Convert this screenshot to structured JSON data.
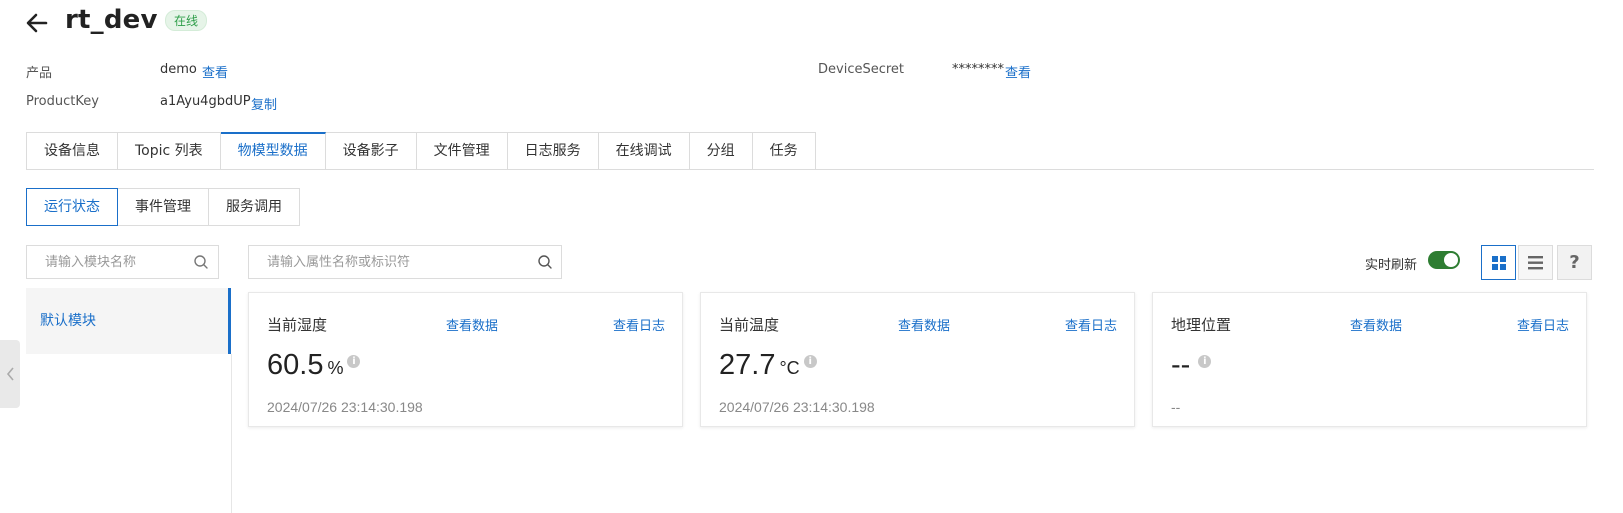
{
  "device": {
    "name": "rt_dev",
    "status": "在线"
  },
  "meta": {
    "product_label": "产品",
    "product_value": "demo",
    "product_link": "查看",
    "productkey_label": "ProductKey",
    "productkey_value": "a1Ayu4gbdUP",
    "productkey_link": "复制",
    "secret_label": "DeviceSecret",
    "secret_value": "********",
    "secret_link": "查看"
  },
  "tabs": [
    {
      "label": "设备信息"
    },
    {
      "label": "Topic 列表"
    },
    {
      "label": "物模型数据"
    },
    {
      "label": "设备影子"
    },
    {
      "label": "文件管理"
    },
    {
      "label": "日志服务"
    },
    {
      "label": "在线调试"
    },
    {
      "label": "分组"
    },
    {
      "label": "任务"
    }
  ],
  "subtabs": [
    {
      "label": "运行状态"
    },
    {
      "label": "事件管理"
    },
    {
      "label": "服务调用"
    }
  ],
  "module_search": {
    "placeholder": "请输入模块名称"
  },
  "modules": [
    {
      "label": "默认模块"
    }
  ],
  "property_search": {
    "placeholder": "请输入属性名称或标识符"
  },
  "toolbar": {
    "refresh_label": "实时刷新",
    "refresh_on": true,
    "help_label": "?"
  },
  "cards": [
    {
      "title": "当前湿度",
      "view_data": "查看数据",
      "view_log": "查看日志",
      "value": "60.5",
      "unit": "%",
      "time": "2024/07/26 23:14:30.198"
    },
    {
      "title": "当前温度",
      "view_data": "查看数据",
      "view_log": "查看日志",
      "value": "27.7",
      "unit": "°C",
      "time": "2024/07/26 23:14:30.198"
    },
    {
      "title": "地理位置",
      "view_data": "查看数据",
      "view_log": "查看日志",
      "value": "--",
      "unit": "",
      "time": "--"
    }
  ],
  "colors": {
    "accent": "#1a6fc9",
    "online_badge": "#2e9e49",
    "toggle_on": "#2e7d32"
  }
}
